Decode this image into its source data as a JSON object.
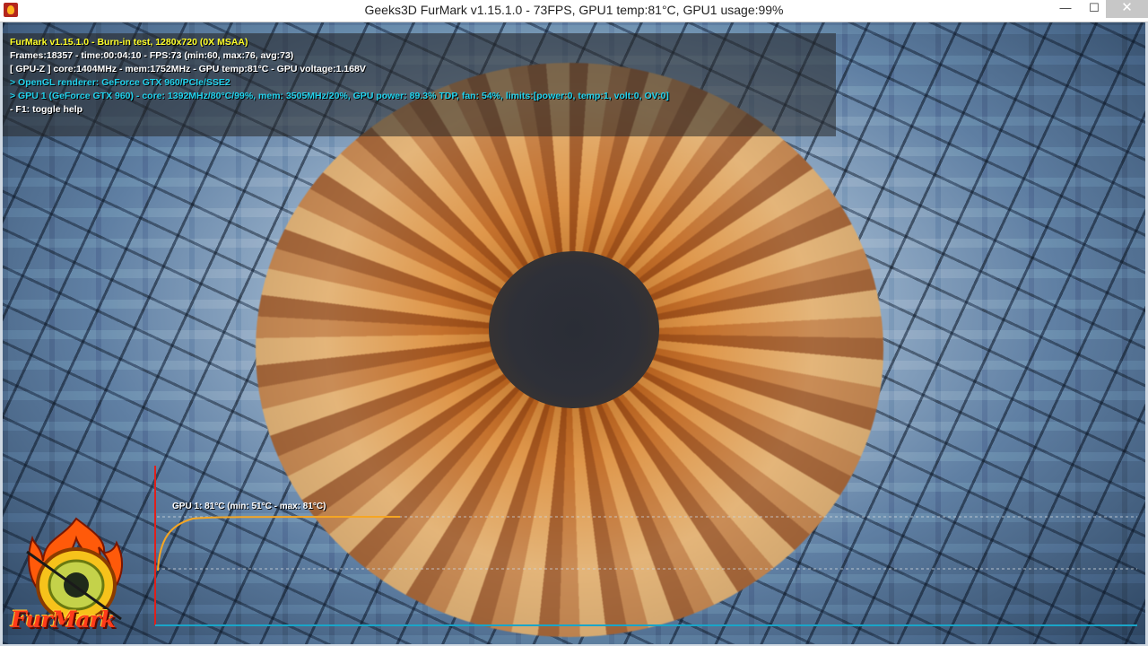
{
  "window": {
    "title": "Geeks3D FurMark v1.15.1.0 - 73FPS, GPU1 temp:81°C, GPU1 usage:99%",
    "icon": "furmark-flame-icon",
    "controls": {
      "minimize": "—",
      "maximize": "☐",
      "close": "✕"
    }
  },
  "osd": {
    "title": "FurMark v1.15.1.0 - Burn-in test, 1280x720 (0X MSAA)",
    "frames": "Frames:18357 - time:00:04:10 - FPS:73 (min:60, max:76, avg:73)",
    "gpuz": "[ GPU-Z ] core:1404MHz - mem:1752MHz - GPU temp:81°C - GPU voltage:1.168V",
    "renderer": "> OpenGL renderer: GeForce GTX 960/PCIe/SSE2",
    "gpu1": "> GPU 1 (GeForce GTX 960) - core: 1392MHz/80°C/99%, mem: 3505MHz/20%, GPU power: 89.3% TDP, fan: 54%, limits:[power:0, temp:1, volt:0, OV:0]",
    "help": "- F1: toggle help"
  },
  "temperature_graph": {
    "label": "GPU 1: 81°C (min: 51°C - max: 81°C)",
    "colors": {
      "line": "#f5a623",
      "axis_y": "#e0201b",
      "axis_x": "#1aa5c8",
      "guide": "#cfd6dd"
    }
  },
  "logo": {
    "text": "FurMark"
  },
  "colors": {
    "osd_title": "#ffff2a",
    "osd_cyan": "#22d3ee"
  }
}
